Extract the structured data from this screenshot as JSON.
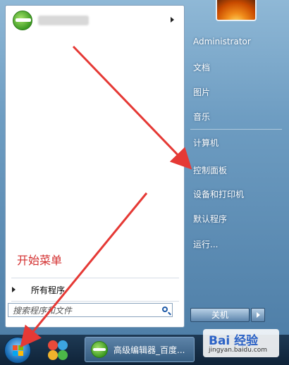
{
  "start_menu": {
    "all_programs_label": "所有程序",
    "search_placeholder": "搜索程序和文件",
    "annotation": "开始菜单",
    "right_items": [
      "Administrator",
      "文档",
      "图片",
      "音乐",
      "计算机",
      "控制面板",
      "设备和打印机",
      "默认程序",
      "运行..."
    ],
    "shutdown_label": "关机"
  },
  "taskbar": {
    "window_label": "高级编辑器_百度..."
  },
  "watermark": {
    "brand": "Bai 经验",
    "url": "jingyan.baidu.com"
  },
  "colors": {
    "annotation_red": "#d32f2f",
    "arrow_red": "#e53935"
  },
  "icons": [
    "ie-icon",
    "submenu-arrow-icon",
    "search-icon",
    "user-picture",
    "windows-start-icon",
    "shutdown-arrow-icon"
  ]
}
